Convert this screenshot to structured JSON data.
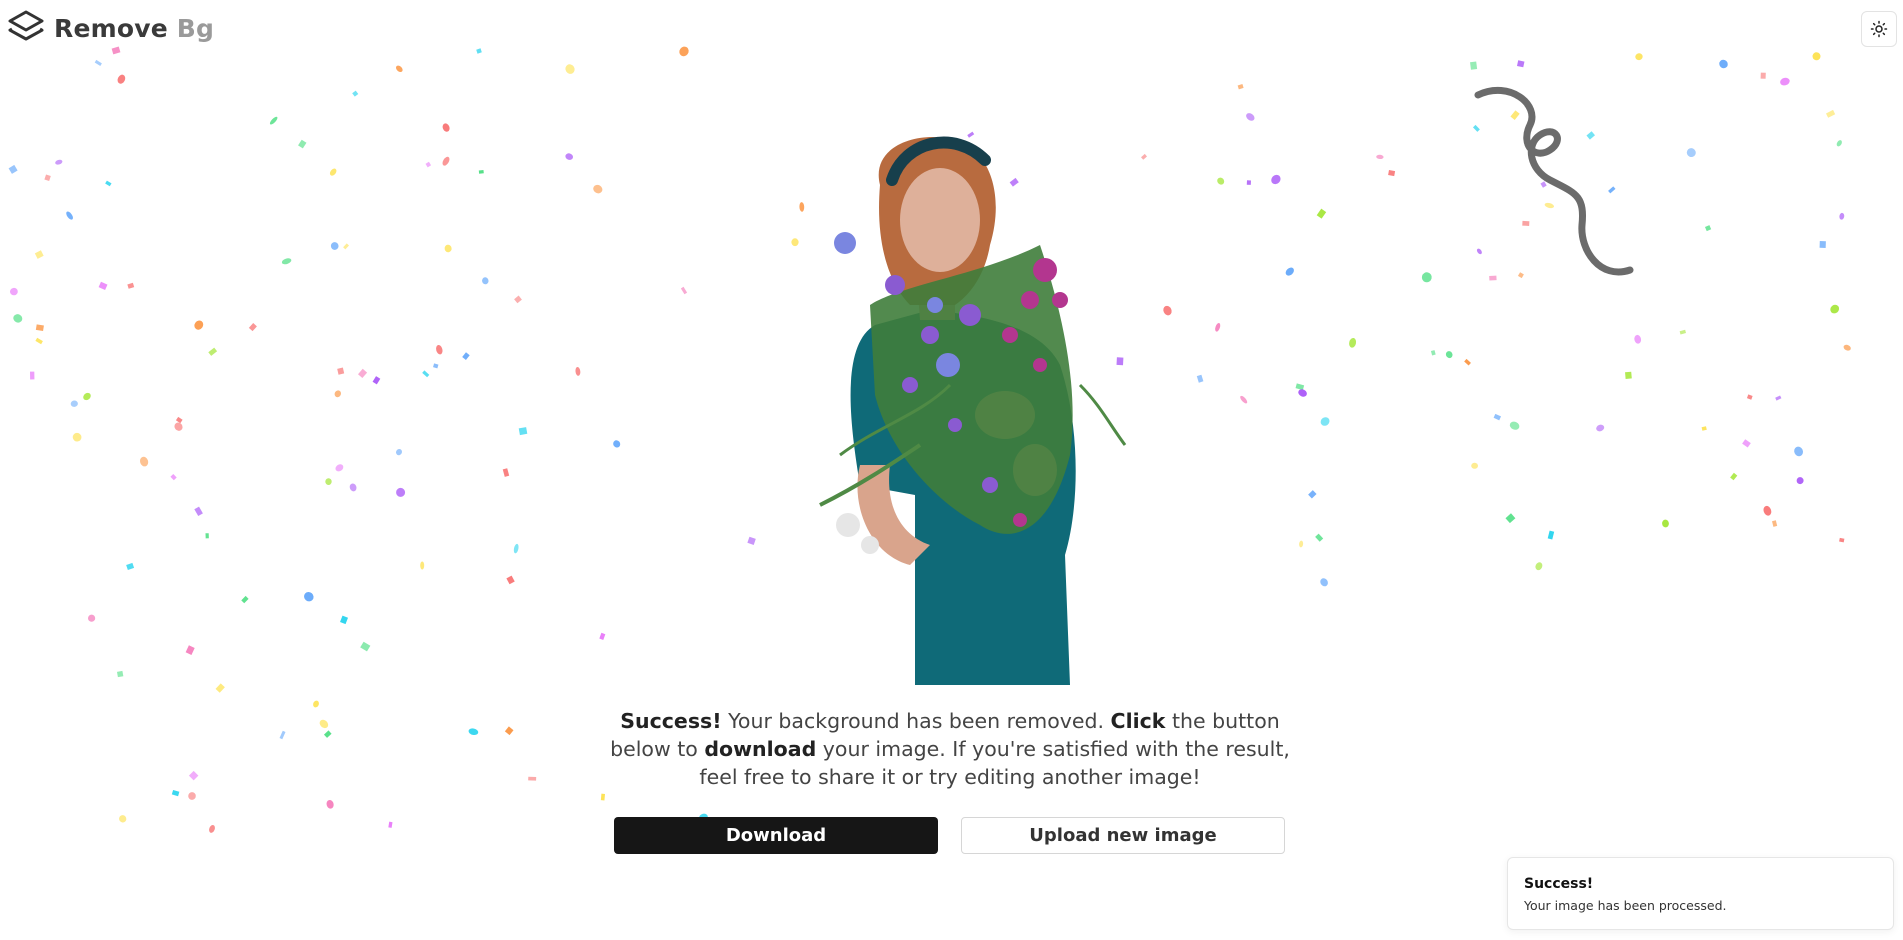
{
  "header": {
    "logo_word_1": "Remove",
    "logo_word_2": "Bg",
    "theme_toggle_icon": "sun-icon"
  },
  "result": {
    "image_icon": "person-with-flowers-image"
  },
  "message": {
    "part1_bold": "Success!",
    "part2": " Your background has been removed. ",
    "part3_bold": "Click",
    "part4": " the button below to ",
    "part5_bold": "download",
    "part6": " your image. If you're satisfied with the result, feel free to share it or try editing another image!"
  },
  "actions": {
    "download_label": "Download",
    "upload_label": "Upload new image"
  },
  "toast": {
    "title": "Success!",
    "description": "Your image has been processed."
  },
  "colors": {
    "download_bg": "#161616",
    "confetti": [
      "#f87171",
      "#a855f7",
      "#22d3ee",
      "#fb923c",
      "#fde047",
      "#4ade80",
      "#e879f9",
      "#60a5fa",
      "#f472b6",
      "#a3e635"
    ]
  }
}
